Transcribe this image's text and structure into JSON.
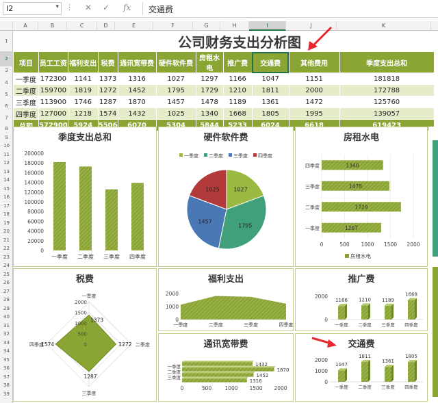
{
  "formula_bar": {
    "name_box": "I2",
    "fx": "fx",
    "content": "交通费"
  },
  "columns": [
    "A",
    "B",
    "C",
    "D",
    "E",
    "F",
    "G",
    "H",
    "I",
    "J",
    "K"
  ],
  "rows": [
    "1",
    "2",
    "3",
    "4",
    "5",
    "6",
    "7",
    "8",
    "9",
    "10",
    "11",
    "12",
    "13",
    "14",
    "15",
    "16",
    "17",
    "18",
    "19",
    "20",
    "21",
    "22",
    "23",
    "24",
    "25",
    "26",
    "27",
    "28",
    "29",
    "30",
    "31",
    "32",
    "33",
    "34",
    "35",
    "36",
    "37",
    "38",
    "39"
  ],
  "title": "公司财务支出分析图",
  "table": {
    "headers": [
      "项目",
      "员工工资",
      "福利支出",
      "税费",
      "通讯宽带费",
      "硬件软件费",
      "房租水电",
      "推广费",
      "交通费",
      "其他费用",
      "季度支出总和"
    ],
    "rows": [
      [
        "一季度",
        "172300",
        "1141",
        "1373",
        "1316",
        "1027",
        "1297",
        "1166",
        "1047",
        "1151",
        "181818"
      ],
      [
        "二季度",
        "159700",
        "1819",
        "1272",
        "1452",
        "1795",
        "1729",
        "1210",
        "1811",
        "2000",
        "172788"
      ],
      [
        "三季度",
        "113900",
        "1746",
        "1287",
        "1870",
        "1457",
        "1478",
        "1189",
        "1361",
        "1472",
        "125760"
      ],
      [
        "四季度",
        "127000",
        "1218",
        "1574",
        "1432",
        "1025",
        "1340",
        "1668",
        "1805",
        "1995",
        "139057"
      ]
    ],
    "total": [
      "总和",
      "572900",
      "5924",
      "5506",
      "6070",
      "5304",
      "5844",
      "5233",
      "6024",
      "6618",
      "619423"
    ]
  },
  "chart_data": [
    {
      "type": "bar",
      "title": "季度支出总和",
      "categories": [
        "一季度",
        "二季度",
        "三季度",
        "四季度"
      ],
      "values": [
        181818,
        172788,
        125760,
        139057
      ],
      "ylim": [
        0,
        200000
      ],
      "yticks": [
        "0",
        "20000",
        "40000",
        "60000",
        "80000",
        "100000",
        "120000",
        "140000",
        "160000",
        "180000",
        "200000"
      ]
    },
    {
      "type": "pie",
      "title": "硬件软件费",
      "legend": [
        "一季度",
        "二季度",
        "三季度",
        "四季度"
      ],
      "values": [
        1027,
        1795,
        1457,
        1025
      ],
      "colors": [
        "#9bb840",
        "#3fa07a",
        "#4a78b5",
        "#b23a3a"
      ]
    },
    {
      "type": "bar",
      "orientation": "horizontal",
      "title": "房租水电",
      "categories": [
        "一季度",
        "二季度",
        "三季度",
        "四季度"
      ],
      "values": [
        1297,
        1729,
        1478,
        1340
      ],
      "xlim": [
        0,
        2000
      ],
      "xticks": [
        "0",
        "500",
        "1000",
        "1500",
        "2000"
      ],
      "legend": "房租水电"
    },
    {
      "type": "radar",
      "title": "税费",
      "categories": [
        "一季度",
        "二季度",
        "三季度",
        "四季度"
      ],
      "values": [
        1373,
        1272,
        1287,
        1574
      ],
      "ticks": [
        "0",
        "500",
        "1000",
        "1500",
        "2000"
      ]
    },
    {
      "type": "area",
      "title": "福利支出",
      "categories": [
        "一季度",
        "二季度",
        "三季度",
        "四季度"
      ],
      "values": [
        1141,
        1819,
        1746,
        1218
      ],
      "ylim": [
        0,
        2000
      ],
      "yticks": [
        "0",
        "1000",
        "2000"
      ]
    },
    {
      "type": "bar",
      "title": "推广费",
      "categories": [
        "一季度",
        "二季度",
        "三季度",
        "四季度"
      ],
      "values": [
        1166,
        1210,
        1189,
        1668
      ],
      "ylim": [
        0,
        2000
      ],
      "yticks": [
        "0",
        "2000"
      ]
    },
    {
      "type": "bar",
      "orientation": "horizontal",
      "title": "通讯宽带费",
      "categories": [
        "一季度",
        "二季度",
        "三季度",
        "四季度"
      ],
      "values": [
        1316,
        1452,
        1870,
        1432
      ],
      "xlim": [
        0,
        2000
      ],
      "xticks": [
        "0",
        "500",
        "1000",
        "1500",
        "2000"
      ],
      "tick_labels": [
        "一季度",
        "二季度",
        "三季度"
      ]
    },
    {
      "type": "bar",
      "title": "交通费",
      "categories": [
        "一季度",
        "二季度",
        "三季度",
        "四季度"
      ],
      "values": [
        1047,
        1811,
        1361,
        1805
      ],
      "ylim": [
        0,
        2000
      ],
      "yticks": [
        "0",
        "1000",
        "2000"
      ]
    }
  ],
  "colors": {
    "accent": "#8aa534",
    "band": "#e4ecc9",
    "bar": "#8aa534",
    "arrow": "#e8262e",
    "select": "#217346"
  }
}
